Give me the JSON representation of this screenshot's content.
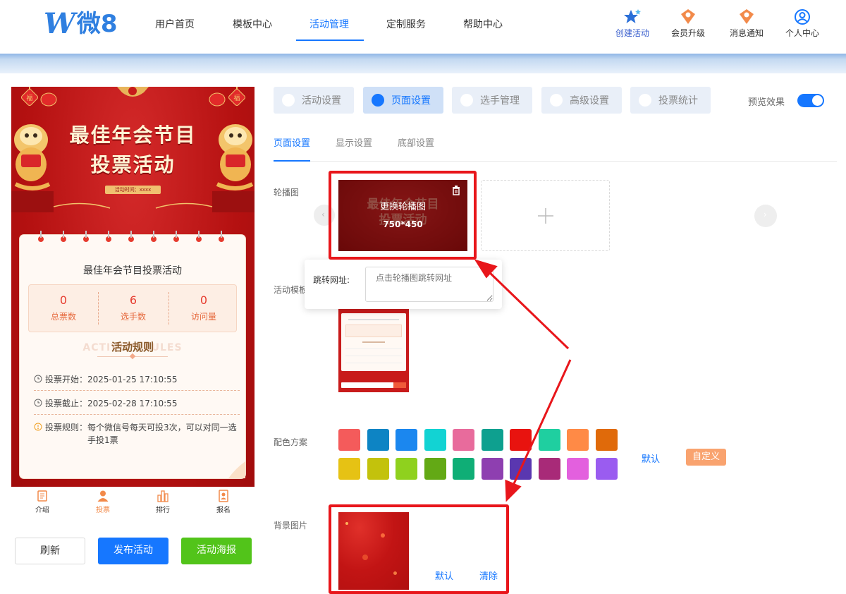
{
  "header": {
    "logo_text": "微8",
    "nav": [
      "用户首页",
      "模板中心",
      "活动管理",
      "定制服务",
      "帮助中心"
    ],
    "right_actions": [
      {
        "label": "创建活动",
        "icon": "star-icon"
      },
      {
        "label": "会员升级",
        "icon": "crown-icon"
      },
      {
        "label": "消息通知",
        "icon": "bell-icon"
      },
      {
        "label": "个人中心",
        "icon": "user-icon"
      }
    ]
  },
  "preview": {
    "banner_title_line1": "最佳年会节目",
    "banner_title_line2": "投票活动",
    "banner_time": "活动时间：xxxx",
    "card_title": "最佳年会节目投票活动",
    "stats": [
      {
        "value": "0",
        "label": "总票数"
      },
      {
        "value": "6",
        "label": "选手数"
      },
      {
        "value": "0",
        "label": "访问量"
      }
    ],
    "rules_ghost": "ACTIVITY RULES",
    "rules_title": "活动规则",
    "rules": [
      {
        "label": "投票开始：",
        "value": "2025-01-25 17:10:55"
      },
      {
        "label": "投票截止：",
        "value": "2025-02-28 17:10:55"
      },
      {
        "label": "投票规则：",
        "value": "每个微信号每天可投3次，可以对同一选手投1票"
      }
    ],
    "tabs": [
      {
        "label": "介绍",
        "icon": "document-icon"
      },
      {
        "label": "投票",
        "icon": "person-icon"
      },
      {
        "label": "排行",
        "icon": "ranking-icon"
      },
      {
        "label": "报名",
        "icon": "signup-icon"
      }
    ]
  },
  "bottom_buttons": {
    "refresh": "刷新",
    "publish": "发布活动",
    "poster": "活动海报"
  },
  "settings_tabs": [
    "活动设置",
    "页面设置",
    "选手管理",
    "高级设置",
    "投票统计"
  ],
  "preview_effect_label": "预览效果",
  "sub_tabs": [
    "页面设置",
    "显示设置",
    "底部设置"
  ],
  "carousel": {
    "label": "轮播图",
    "overlay_text": "更换轮播图",
    "size_text": "750*450",
    "bg_title_line1": "最佳年会节目",
    "bg_title_line2": "投票活动",
    "jump_label": "跳转网址:",
    "jump_placeholder": "点击轮播图跳转网址"
  },
  "template_label": "活动模板",
  "color_scheme": {
    "label": "配色方案",
    "colors": [
      "#f45b5b",
      "#0d84c4",
      "#1b87ef",
      "#12d3d3",
      "#e86b9c",
      "#0ea08f",
      "#e8130f",
      "#1fcfa0",
      "#ff8a46",
      "#e06a0a",
      "#e6c214",
      "#c3c20c",
      "#8fd11e",
      "#63a915",
      "#0fae76",
      "#8e3fb0",
      "#5a37b0",
      "#a82a78",
      "#e360de",
      "#9a5cf0"
    ],
    "default_label": "默认",
    "custom_label": "自定义"
  },
  "background": {
    "label": "背景图片",
    "default_label": "默认",
    "clear_label": "清除"
  }
}
